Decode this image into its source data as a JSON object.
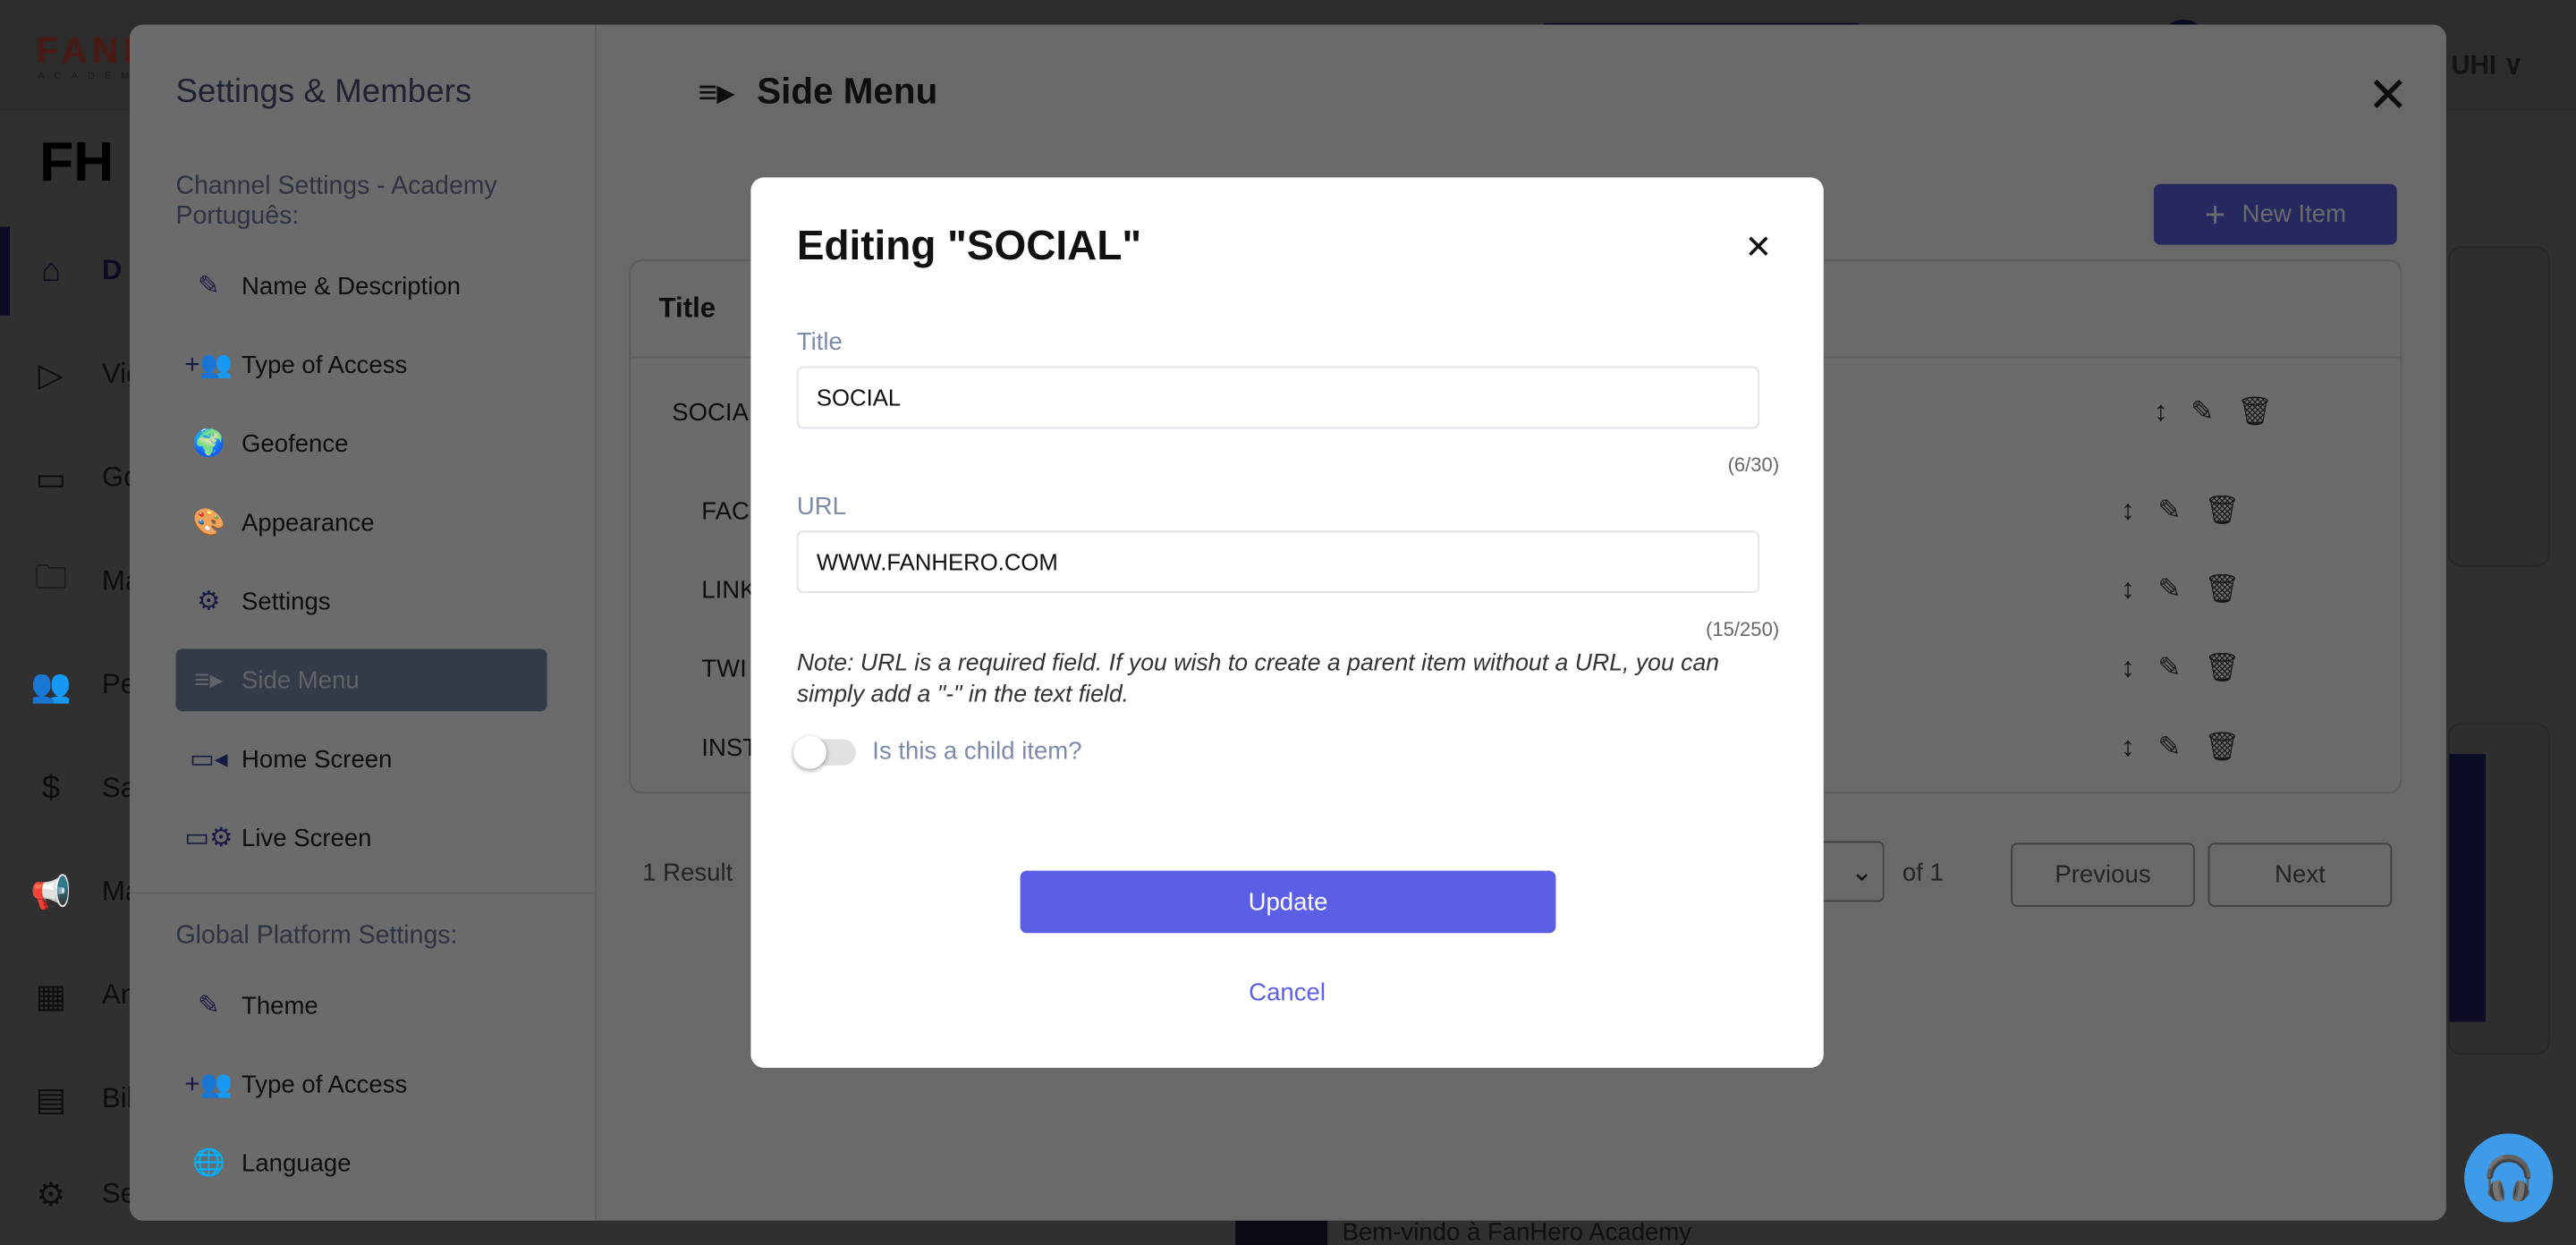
{
  "background": {
    "brand": "FANHERO",
    "brand_sub": "ACADEMY",
    "logo": "FH",
    "user": "UHI",
    "nav": [
      {
        "icon": "home-icon",
        "label": "D",
        "glyph": "⌂"
      },
      {
        "icon": "play-circle-icon",
        "label": "Vid",
        "glyph": "▷"
      },
      {
        "icon": "tv-play-icon",
        "label": "Go",
        "glyph": "▭"
      },
      {
        "icon": "folder-gear-icon",
        "label": "Ma",
        "glyph": "🗀"
      },
      {
        "icon": "people-icon",
        "label": "Pe",
        "glyph": "👥"
      },
      {
        "icon": "dollar-icon",
        "label": "Sal",
        "glyph": "$"
      },
      {
        "icon": "megaphone-icon",
        "label": "Ma",
        "glyph": "📢"
      },
      {
        "icon": "analytics-icon",
        "label": "An",
        "glyph": "▦"
      },
      {
        "icon": "billing-icon",
        "label": "Bil",
        "glyph": "▤"
      },
      {
        "icon": "gear-icon",
        "label": "Se",
        "glyph": "⚙"
      }
    ],
    "bottom_text": "Bem-vindo à FanHero Academy"
  },
  "settings_panel": {
    "title": "Settings & Members",
    "channel_heading": "Channel Settings - Academy Português:",
    "channel_items": [
      {
        "label": "Name & Description",
        "icon": "pencil-icon",
        "glyph": "✎"
      },
      {
        "label": "Type of Access",
        "icon": "add-group-icon",
        "glyph": "+👥"
      },
      {
        "label": "Geofence",
        "icon": "globe-icon",
        "glyph": "🌍"
      },
      {
        "label": "Appearance",
        "icon": "palette-icon",
        "glyph": "🎨"
      },
      {
        "label": "Settings",
        "icon": "gear-icon",
        "glyph": "⚙"
      },
      {
        "label": "Side Menu",
        "icon": "playlist-icon",
        "glyph": "≡▸",
        "selected": true
      },
      {
        "label": "Home Screen",
        "icon": "video-camera-icon",
        "glyph": "▭◂"
      },
      {
        "label": "Live Screen",
        "icon": "screen-gear-icon",
        "glyph": "▭⚙"
      }
    ],
    "global_heading": "Global Platform Settings:",
    "global_items": [
      {
        "label": "Theme",
        "icon": "pencil-icon",
        "glyph": "✎"
      },
      {
        "label": "Type of Access",
        "icon": "add-group-icon",
        "glyph": "+👥"
      },
      {
        "label": "Language",
        "icon": "globe-grid-icon",
        "glyph": "🌐"
      }
    ],
    "main_title": "Side Menu",
    "new_item_label": "New Item",
    "table_header": "Title",
    "rows": [
      {
        "title": "SOCIA",
        "child": false
      },
      {
        "title": "FAC",
        "child": true
      },
      {
        "title": "LINK",
        "child": true
      },
      {
        "title": "TWI",
        "child": true
      },
      {
        "title": "INST",
        "child": true
      }
    ],
    "result_count": "1 Result",
    "page_of": "of 1",
    "previous_label": "Previous",
    "next_label": "Next"
  },
  "modal": {
    "title": "Editing \"SOCIAL\"",
    "title_label": "Title",
    "title_value": "SOCIAL",
    "title_count": "(6/30)",
    "url_label": "URL",
    "url_value": "WWW.FANHERO.COM",
    "url_count": "(15/250)",
    "note": "Note: URL is a required field. If you wish to create a parent item without a URL, you can simply add a \"-\" in the text field.",
    "child_toggle_label": "Is this a child item?",
    "child_toggle_on": false,
    "update_label": "Update",
    "cancel_label": "Cancel"
  },
  "colors": {
    "accent": "#5b5fe6",
    "label": "#7d8bab",
    "help": "#3d9be9"
  }
}
